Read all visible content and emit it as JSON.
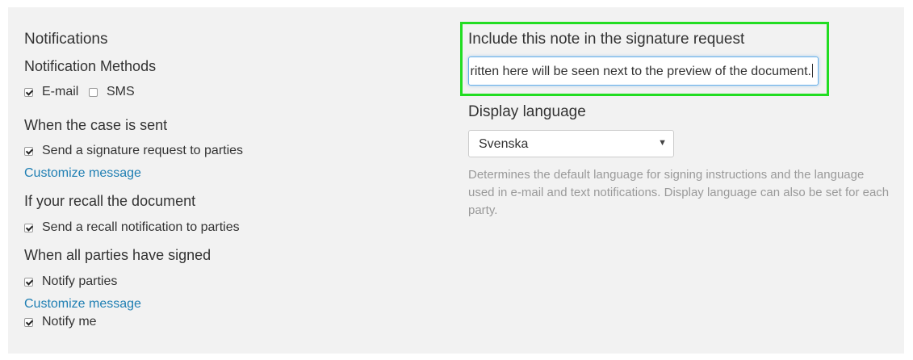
{
  "notifications": {
    "title": "Notifications",
    "methods_title": "Notification Methods",
    "email_label": "E-mail",
    "email_checked": true,
    "sms_label": "SMS",
    "sms_checked": false
  },
  "case_sent": {
    "title": "When the case is sent",
    "send_request_label": "Send a signature request to parties",
    "send_request_checked": true,
    "customize_link": "Customize message"
  },
  "recall": {
    "title": "If your recall the document",
    "send_recall_label": "Send a recall notification to parties",
    "send_recall_checked": true
  },
  "all_signed": {
    "title": "When all parties have signed",
    "notify_parties_label": "Notify parties",
    "notify_parties_checked": true,
    "customize_link": "Customize message",
    "notify_me_label": "Notify me",
    "notify_me_checked": true
  },
  "note": {
    "title": "Include this note in the signature request",
    "visible_value": "ritten here will be seen next to the preview of the document."
  },
  "language": {
    "title": "Display language",
    "selected": "Svenska",
    "help": "Determines the default language for signing instructions and the language used in e-mail and text notifications. Display language can also be set for each party."
  },
  "colors": {
    "panel_bg": "#f2f2f2",
    "link": "#1f7fb3",
    "highlight": "#22dd22",
    "help_text": "#9a9a9a"
  }
}
